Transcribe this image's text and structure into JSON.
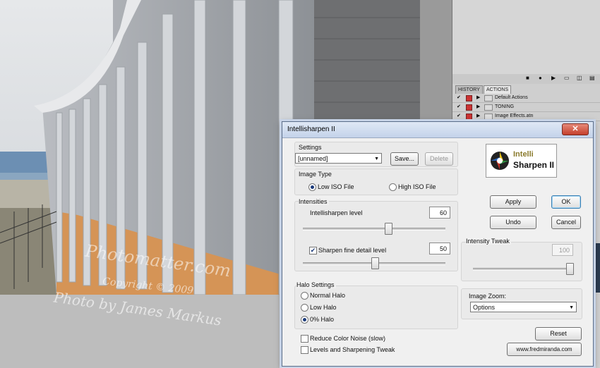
{
  "panel": {
    "tab_history": "HISTORY",
    "tab_actions": "ACTIONS",
    "actions": [
      {
        "label": "Default Actions"
      },
      {
        "label": "TONING"
      },
      {
        "label": "Image Effects.atn"
      }
    ]
  },
  "watermark": {
    "line1": "Photomatter.com",
    "line2": "Copyright © 2009",
    "line3": "Photo by James Markus"
  },
  "dialog": {
    "title": "Intellisharpen II",
    "close_label": "✕",
    "settings": {
      "label": "Settings",
      "selected": "[unnamed]",
      "save_label": "Save...",
      "delete_label": "Delete"
    },
    "logo": {
      "line1": "Intelli",
      "line2": "Sharpen II"
    },
    "image_type": {
      "label": "Image Type",
      "low_iso": "Low ISO File",
      "high_iso": "High ISO File"
    },
    "intensities": {
      "label": "Intensities",
      "level_label": "Intellisharpen level",
      "level_value": "60",
      "fine_label": "Sharpen fine detail level",
      "fine_value": "50"
    },
    "apply_label": "Apply",
    "ok_label": "OK",
    "undo_label": "Undo",
    "cancel_label": "Cancel",
    "intensity_tweak": {
      "label": "Intensity Tweak",
      "value": "100"
    },
    "halo": {
      "label": "Halo Settings",
      "normal": "Normal Halo",
      "low": "Low Halo",
      "zero": "0% Halo"
    },
    "image_zoom": {
      "label": "Image Zoom:",
      "selected": "Options"
    },
    "reset_label": "Reset",
    "reduce_noise_label": "Reduce Color Noise (slow)",
    "levels_tweak_label": "Levels and Sharpening Tweak",
    "link_label": "www.fredmiranda.com"
  },
  "colors": {
    "accent": "#1b3a7a",
    "close": "#c5402c",
    "dialog_bg": "#f0f0f0"
  }
}
